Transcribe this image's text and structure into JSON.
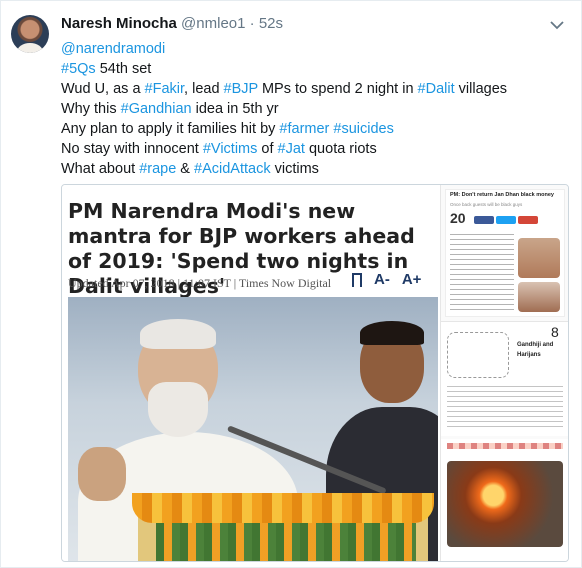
{
  "tweet": {
    "name": "Naresh Minocha",
    "handle": "@nmleo1",
    "dot": "·",
    "time": "52s",
    "reply_to": "@narendramodi",
    "lines": [
      [
        {
          "t": "#5Qs",
          "link": true
        },
        {
          "t": " 54th set",
          "link": false
        }
      ],
      [
        {
          "t": "Wud U, as a ",
          "link": false
        },
        {
          "t": "#Fakir",
          "link": true
        },
        {
          "t": ", lead ",
          "link": false
        },
        {
          "t": "#BJP",
          "link": true
        },
        {
          "t": " MPs to spend 2 night in ",
          "link": false
        },
        {
          "t": "#Dalit",
          "link": true
        },
        {
          "t": " villages",
          "link": false
        }
      ],
      [
        {
          "t": "Why this ",
          "link": false
        },
        {
          "t": "#Gandhian",
          "link": true
        },
        {
          "t": " idea in 5th yr",
          "link": false
        }
      ],
      [
        {
          "t": "Any plan to apply it families hit by ",
          "link": false
        },
        {
          "t": "#farmer",
          "link": true
        },
        {
          "t": " ",
          "link": false
        },
        {
          "t": "#suicides",
          "link": true
        }
      ],
      [
        {
          "t": "No stay with innocent ",
          "link": false
        },
        {
          "t": "#Victims",
          "link": true
        },
        {
          "t": " of ",
          "link": false
        },
        {
          "t": "#Jat",
          "link": true
        },
        {
          "t": " quota riots",
          "link": false
        }
      ],
      [
        {
          "t": "What about ",
          "link": false
        },
        {
          "t": "#rape",
          "link": true
        },
        {
          "t": " & ",
          "link": false
        },
        {
          "t": "#AcidAttack",
          "link": true
        },
        {
          "t": " victims",
          "link": false
        }
      ]
    ]
  },
  "card": {
    "headline": "PM Narendra Modi's new mantra for BJP workers ahead of 2019: 'Spend two nights in Dalit villages'",
    "meta": "Updated Apr 07, 2018 | 11:07 IST | Times Now Digital",
    "font_minus": "A-",
    "font_plus": "A+",
    "right": {
      "title": "PM: Don't return Jan Dhan black money",
      "sub": "Once back guests will be black guys",
      "count": "20",
      "r2_number": "8",
      "r2_title_a": "Gandhiji and",
      "r2_title_b": "Harijans"
    }
  },
  "colors": {
    "link": "#1b95e0",
    "text": "#14171a",
    "muted": "#657786"
  },
  "icons": {
    "menu": "chevron-down-icon",
    "bookmark": "bookmark-icon"
  }
}
